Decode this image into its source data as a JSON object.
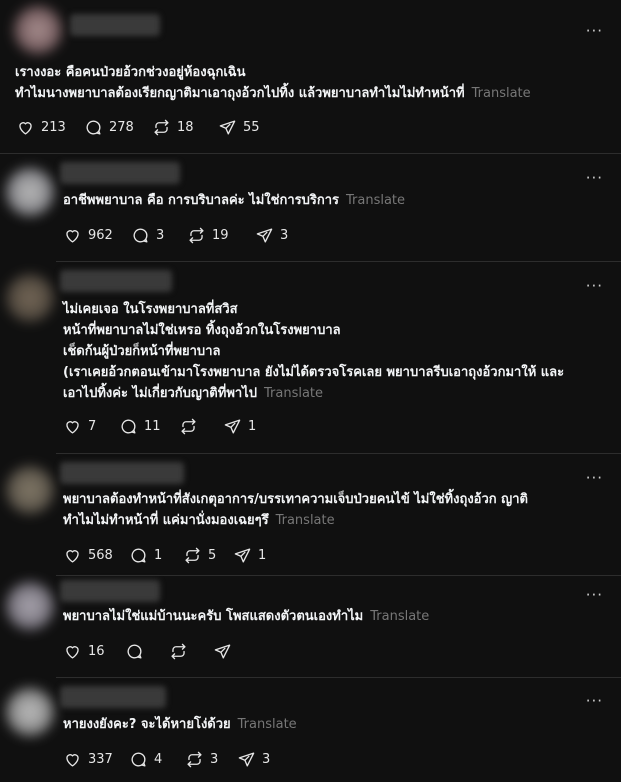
{
  "more_label": "···",
  "translate_label": "Translate",
  "posts": [
    {
      "lines": [
        "เรางงอะ คือคนป่วยอ้วกช่วงอยู่ห้องฉุกเฉิน",
        "ทำไมนางพยาบาลต้องเรียกญาติมาเอาถุงอ้วกไปทิ้ง แล้วพยาบาลทำไมไม่ทำหน้าที่"
      ],
      "likes": "213",
      "replies": "278",
      "reposts": "18",
      "shares": "55"
    },
    {
      "lines": [
        "อาชีพพยาบาล คือ การบริบาลค่ะ ไม่ใช่การบริการ"
      ],
      "likes": "962",
      "replies": "3",
      "reposts": "19",
      "shares": "3"
    },
    {
      "lines": [
        "ไม่เคยเจอ ในโรงพยาบาลที่สวิส",
        "หน้าที่พยาบาลไม่ใช่เหรอ ทิ้งถุงอ้วกในโรงพยาบาล",
        "เช็ดก้นผู้ป่วยก็หน้าที่พยาบาล",
        "(เราเคยอ้วกตอนเข้ามาโรงพยาบาล ยังไม่ได้ตรวจโรคเลย พยาบาลรีบเอาถุงอ้วกมาให้ และ",
        "เอาไปทิ้งค่ะ ไม่เกี่ยวกับญาติที่พาไป"
      ],
      "likes": "7",
      "replies": "11",
      "reposts": "",
      "shares": "1"
    },
    {
      "lines": [
        "พยาบาลต้องทำหน้าที่สังเกตุอาการ/บรรเทาความเจ็บป่วยคนไข้ ไม่ใช่ทิ้งถุงอ้วก ญาติ",
        "ทำไมไม่ทำหน้าที่ แค่มานั่งมองเฉยๆรึ"
      ],
      "likes": "568",
      "replies": "1",
      "reposts": "5",
      "shares": "1"
    },
    {
      "lines": [
        "พยาบาลไม่ใช่แม่บ้านนะครับ โพสแสดงตัวตนเองทำไม"
      ],
      "likes": "16",
      "replies": "",
      "reposts": "",
      "shares": ""
    },
    {
      "lines": [
        "หายงงยังคะ? จะได้หายโง่ด้วย"
      ],
      "likes": "337",
      "replies": "4",
      "reposts": "3",
      "shares": "3"
    }
  ]
}
